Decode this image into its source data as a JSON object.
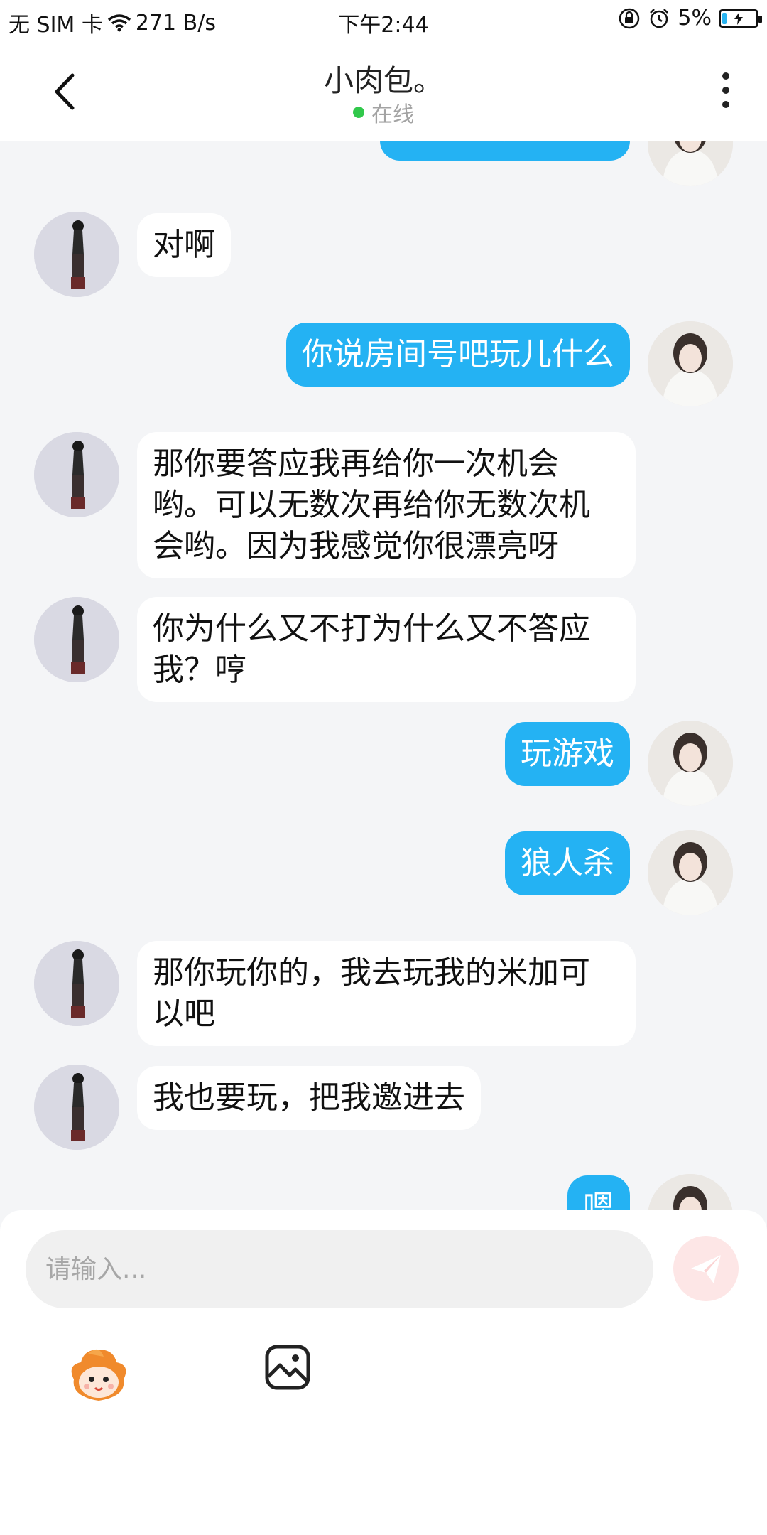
{
  "status_bar": {
    "carrier": "无 SIM 卡",
    "speed": "271 B/s",
    "time": "下午2:44",
    "battery": "5%"
  },
  "header": {
    "title": "小肉包。",
    "status": "在线"
  },
  "messages": [
    {
      "from": "me",
      "text": "你想学数学吗？"
    },
    {
      "from": "them",
      "text": "对啊"
    },
    {
      "from": "me",
      "text": "你说房间号吧玩儿什么"
    },
    {
      "from": "them",
      "text": "那你要答应我再给你一次机会哟。可以无数次再给你无数次机会哟。因为我感觉你很漂亮呀"
    },
    {
      "from": "them",
      "text": "你为什么又不打为什么又不答应我？哼"
    },
    {
      "from": "me",
      "text": "玩游戏"
    },
    {
      "from": "me",
      "text": "狼人杀"
    },
    {
      "from": "them",
      "text": "那你玩你的，我去玩我的米加可以吧"
    },
    {
      "from": "them",
      "text": "我也要玩，把我邀进去"
    },
    {
      "from": "me",
      "text": "嗯"
    }
  ],
  "composer": {
    "placeholder": "请输入..."
  },
  "colors": {
    "bubble_me": "#24b2f3",
    "bubble_them": "#ffffff",
    "online": "#31c84b",
    "background": "#f4f5f7"
  }
}
